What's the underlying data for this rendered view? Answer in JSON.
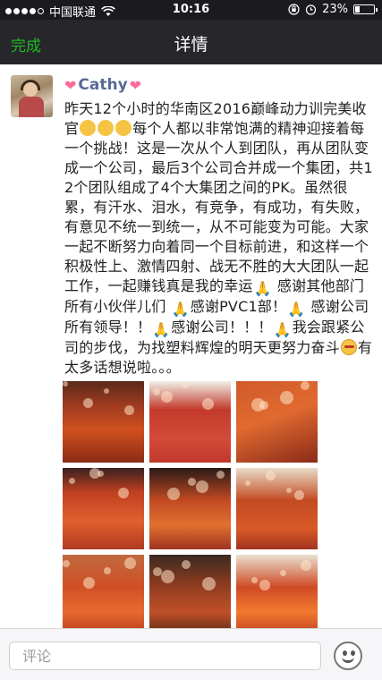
{
  "status_bar": {
    "carrier": "中国联通",
    "time": "10:16",
    "battery_percent": "23%",
    "battery_level": 0.23,
    "icons": [
      "signal-dots-icon",
      "wifi-icon",
      "lock-rotation-icon",
      "alarm-icon",
      "battery-icon"
    ]
  },
  "nav": {
    "done_label": "完成",
    "title": "详情",
    "accent_color": "#1fb922"
  },
  "post": {
    "username": "Cathy",
    "username_color": "#576b95",
    "decorations": [
      "heart-icon",
      "heart-icon"
    ],
    "text_segments": [
      {
        "type": "text",
        "value": "昨天12个小时的华南区2016巅峰动力训完美收官"
      },
      {
        "type": "emoji",
        "name": "grin-emoji"
      },
      {
        "type": "emoji",
        "name": "grin-emoji"
      },
      {
        "type": "emoji",
        "name": "grin-emoji"
      },
      {
        "type": "text",
        "value": "每个人都以非常饱满的精神迎接着每一个挑战！这是一次从个人到团队，再从团队变成一个公司，最后3个公司合并成一个集团，共12个团队组成了4个大集团之间的PK。虽然很累，有汗水、泪水，有竞争，有成功，有失败，有意见不统一到统一，从不可能变为可能。大家一起不断努力向着同一个目标前进，和这样一个积极性上、激情四射、战无不胜的大大团队一起工作，一起赚钱真是我的幸运"
      },
      {
        "type": "emoji",
        "name": "pray-emoji"
      },
      {
        "type": "text",
        "value": " 感谢其他部门所有小伙伴儿们 "
      },
      {
        "type": "emoji",
        "name": "pray-emoji"
      },
      {
        "type": "text",
        "value": "感谢PVC1部！"
      },
      {
        "type": "emoji",
        "name": "pray-emoji"
      },
      {
        "type": "text",
        "value": " 感谢公司所有领导！！"
      },
      {
        "type": "emoji",
        "name": "pray-emoji"
      },
      {
        "type": "text",
        "value": "感谢公司！！！"
      },
      {
        "type": "emoji",
        "name": "pray-emoji"
      },
      {
        "type": "text",
        "value": "我会跟紧公司的步伐，为找塑料辉煌的明天更努力奋斗"
      },
      {
        "type": "emoji",
        "name": "headband-emoji"
      },
      {
        "type": "text",
        "value": "有太多话想说啦。。。"
      }
    ],
    "photos": [
      {
        "name": "photo-team-hall",
        "style": "p-a"
      },
      {
        "name": "photo-stage-game",
        "style": "p-b"
      },
      {
        "name": "photo-kneeling-group",
        "style": "p-c"
      },
      {
        "name": "photo-seated-crowd",
        "style": "p-d"
      },
      {
        "name": "photo-chandelier-hall",
        "style": "p-e"
      },
      {
        "name": "photo-group-cheer",
        "style": "p-f"
      },
      {
        "name": "photo-standing-crowd",
        "style": "p-g"
      },
      {
        "name": "photo-circle-group",
        "style": "p-h"
      },
      {
        "name": "photo-group-banner",
        "style": "p-i"
      }
    ]
  },
  "comment_bar": {
    "placeholder": "评论",
    "emoji_button_icon": "smiley-face-icon"
  }
}
